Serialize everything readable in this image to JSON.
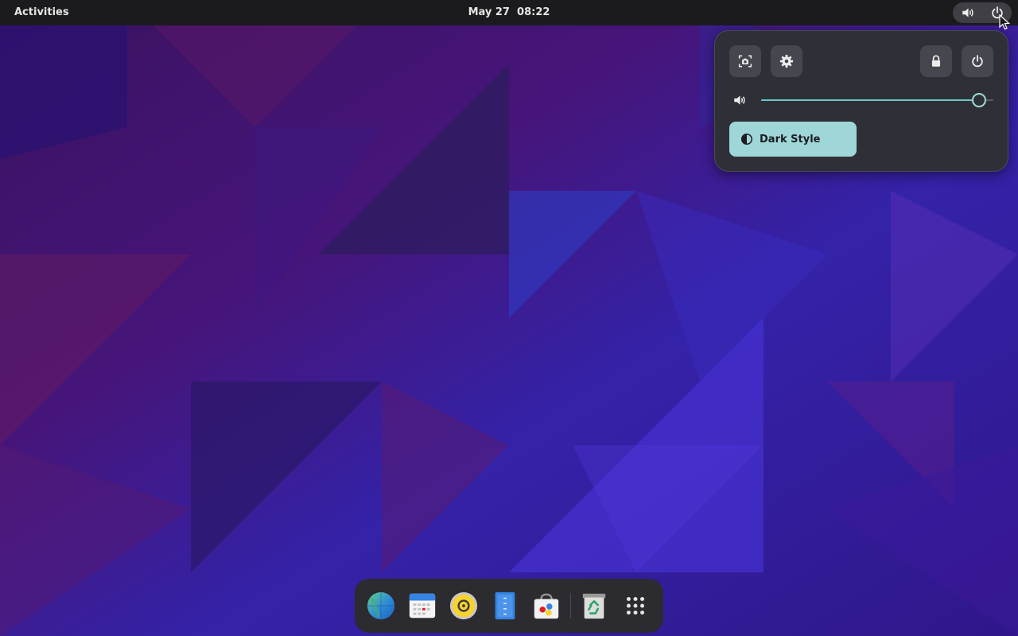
{
  "topbar": {
    "activities_label": "Activities",
    "date": "May 27",
    "time": "08:22",
    "status_icons": [
      "volume-icon",
      "power-icon"
    ]
  },
  "quick_settings": {
    "buttons": [
      "screenshot-icon",
      "gear-icon",
      "lock-icon",
      "power-icon"
    ],
    "volume_level": 0.94,
    "dark_style": {
      "label": "Dark Style",
      "active": true
    }
  },
  "dock": {
    "apps": [
      "web-browser-icon",
      "calendar-icon",
      "rhythmbox-icon",
      "text-editor-icon",
      "software-icon",
      "trash-icon",
      "app-grid-icon"
    ]
  },
  "colors": {
    "accent": "#9fd6d7",
    "slider": "#6dc9c6",
    "panel": "#1b1b1e",
    "menu": "#2f3037"
  }
}
